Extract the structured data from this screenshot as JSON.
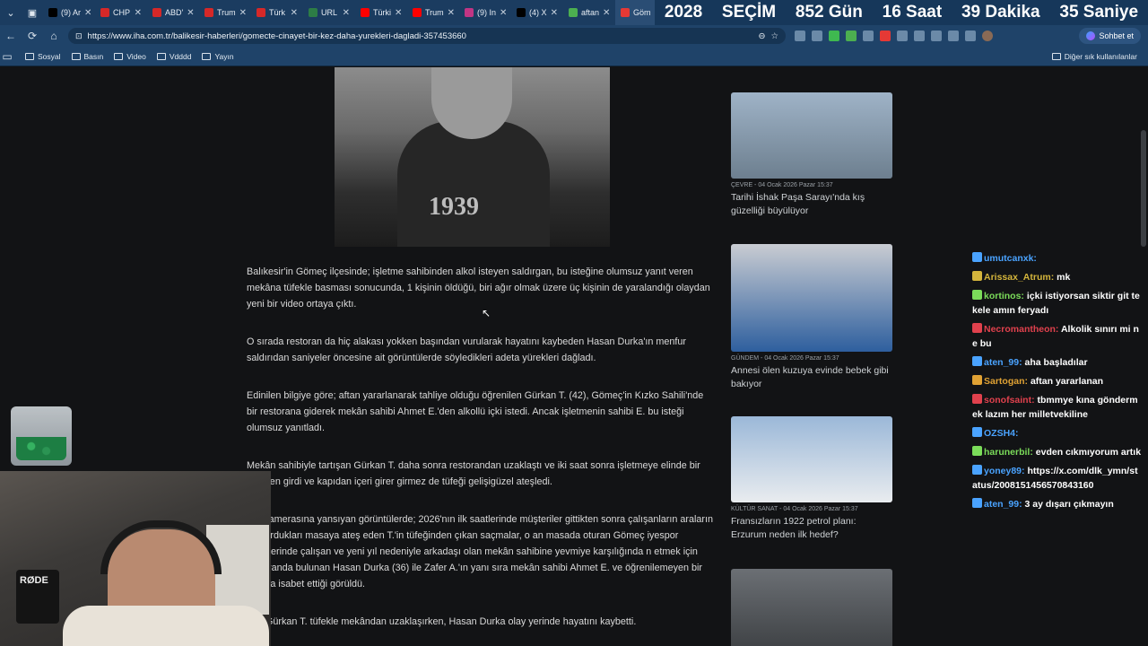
{
  "tabs": [
    {
      "label": "(9) Ar",
      "color": "#000000"
    },
    {
      "label": "CHP",
      "color": "#d62828"
    },
    {
      "label": "ABD'",
      "color": "#d62828"
    },
    {
      "label": "Trum",
      "color": "#d62828"
    },
    {
      "label": "Türk",
      "color": "#d62828"
    },
    {
      "label": "URL",
      "color": "#2d7d46"
    },
    {
      "label": "Türki",
      "color": "#ff0000"
    },
    {
      "label": "Trum",
      "color": "#ff0000"
    },
    {
      "label": "(9) In",
      "color": "#c13584"
    },
    {
      "label": "(4) X",
      "color": "#000000"
    },
    {
      "label": "aftan",
      "color": "#4caf50"
    },
    {
      "label": "Göm",
      "color": "#e53935"
    }
  ],
  "countdown": {
    "year": "2028",
    "label": "SEÇİM",
    "days": "852 Gün",
    "hours": "16 Saat",
    "minutes": "39 Dakika",
    "seconds": "35 Saniye"
  },
  "address_bar": {
    "url": "https://www.iha.com.tr/balikesir-haberleri/gomecte-cinayet-bir-kez-daha-yurekleri-dagladi-357453660",
    "chat_button": "Sohbet et"
  },
  "bookmarks": {
    "items": [
      "Sosyal",
      "Basın",
      "Video",
      "Vdddd",
      "Yayın"
    ],
    "other": "Diğer sık kullanılanlar"
  },
  "article": {
    "paragraphs": [
      "Balıkesir'in Gömeç ilçesinde; işletme sahibinden alkol isteyen saldırgan, bu isteğine olumsuz yanıt veren mekâna tüfekle basması sonucunda, 1 kişinin öldüğü, biri ağır olmak üzere üç kişinin de yaralandığı olaydan yeni bir video ortaya çıktı.",
      "O sırada restoran da hiç alakası yokken başından vurularak hayatını kaybeden Hasan Durka'ın menfur saldırıdan saniyeler öncesine ait görüntülerde söyledikleri adeta yürekleri dağladı.",
      "Edinilen bilgiye göre; aftan yararlanarak tahliye olduğu öğrenilen Gürkan T. (42), Gömeç'in Kızko Sahili'nde bir restorana giderek mekân sahibi Ahmet E.'den alkollü içki istedi. Ancak işletmenin sahibi E. bu isteği olumsuz yanıtladı.",
      "Mekân sahibiyle tartışan Gürkan T. daha sonra restorandan uzaklaştı ve iki saat sonra işletmeye elinde bir yeniden girdi ve kapıdan içeri girer girmez de tüfeği gelişigüzel ateşledi.",
      "nlik kamerasına yansıyan görüntülerde; 2026'nın ilk saatlerinde müşteriler gittikten sonra çalışanların araların da kurdukları masaya ateş eden T.'in tüfeğinden çıkan saçmalar, o an masada oturan Gömeç iyespor Tesislerinde çalışan ve yeni yıl nedeniyle arkadaşı olan mekân sahibine yevmiye karşılığında n etmek için restoranda bulunan Hasan Durka (36) ile Zafer A.'ın yanı sıra mekân sahibi Ahmet E. ve öğrenilemeyen bir kadına isabet ettiği görüldü.",
      "gan Gürkan T. tüfekle mekândan uzaklaşırken, Hasan Durka olay yerinde hayatını kaybetti."
    ]
  },
  "sidebar": {
    "cards": [
      {
        "meta": "ÇEVRE - 04 Ocak 2026 Pazar 15:37",
        "title": "Tarihi İshak Paşa Sarayı'nda kış güzelliği büyülüyor",
        "c1": "#9fb3c7",
        "c2": "#6d7f8f"
      },
      {
        "meta": "GÜNDEM - 04 Ocak 2026 Pazar 15:37",
        "title": "Annesi ölen kuzuya evinde bebek gibi bakıyor",
        "c1": "#c9ccd2",
        "c2": "#2e5f9e"
      },
      {
        "meta": "KÜLTÜR SANAT - 04 Ocak 2026 Pazar 15:37",
        "title": "Fransızların 1922 petrol planı: Erzurum neden ilk hedef?",
        "c1": "#9bb8d8",
        "c2": "#e9ecef"
      },
      {
        "meta": "",
        "title": "",
        "c1": "#6b6f74",
        "c2": "#3a3d40"
      }
    ]
  },
  "chat": {
    "messages": [
      {
        "user": "umutcanxk:",
        "text": "",
        "color": "#4aa3ff"
      },
      {
        "user": "Arissax_Atrum:",
        "text": "mk",
        "color": "#d4b53c"
      },
      {
        "user": "kortinos:",
        "text": "içki istiyorsan siktir git tekele amın feryadı",
        "color": "#7bdc5a"
      },
      {
        "user": "Necromantheon:",
        "text": "Alkolik sınırı mi ne bu",
        "color": "#e0414d"
      },
      {
        "user": "aten_99:",
        "text": "aha başladılar",
        "color": "#4aa3ff"
      },
      {
        "user": "Sartogan:",
        "text": "aftan yararlanan",
        "color": "#e0a234"
      },
      {
        "user": "sonofsaint:",
        "text": "tbmmye kına göndermek lazım her milletvekiline",
        "color": "#e0414d"
      },
      {
        "user": "OZSH4:",
        "text": "",
        "color": "#4aa3ff"
      },
      {
        "user": "harunerbil:",
        "text": "evden cıkmıyorum artık",
        "color": "#7bdc5a"
      },
      {
        "user": "yoney89:",
        "text": "https://x.com/dlk_ymn/status/2008151456570843160",
        "color": "#4aa3ff"
      },
      {
        "user": "aten_99:",
        "text": "3 ay dışarı çıkmayın",
        "color": "#4aa3ff"
      }
    ]
  },
  "webcam": {
    "mic_brand": "RØDE"
  }
}
